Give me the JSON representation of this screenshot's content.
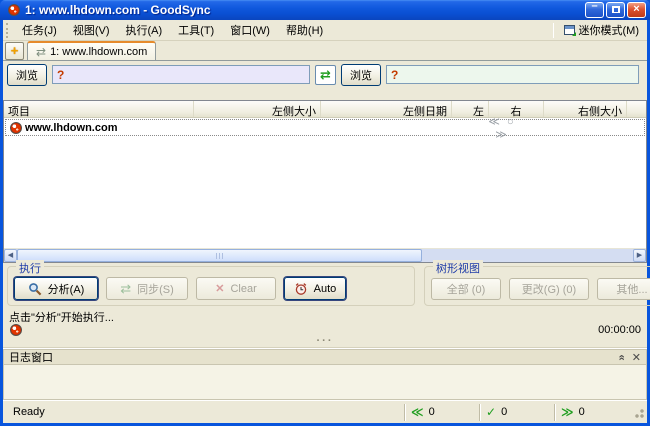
{
  "window": {
    "title": "1: www.lhdown.com - GoodSync",
    "controls": {
      "minimize": "–",
      "close": "×"
    }
  },
  "menu": {
    "items": [
      "任务(J)",
      "视图(V)",
      "执行(A)",
      "工具(T)",
      "窗口(W)",
      "帮助(H)"
    ],
    "mini_mode_label": "迷你模式(M)"
  },
  "tabbar": {
    "new_tab_label": "+",
    "tab_sync_icon": "⇄",
    "active_tab": "1: www.lhdown.com"
  },
  "sync_paths": {
    "left_browse_label": "浏览",
    "left_value": "?",
    "swap_icon": "⇄",
    "right_browse_label": "浏览",
    "right_value": "?"
  },
  "file_list": {
    "columns": [
      "项目",
      "左侧大小",
      "左侧日期",
      "左",
      "右",
      "右侧大小"
    ],
    "rows": [
      {
        "name": "www.lhdown.com",
        "direction_icons": "≪ ○ ≫"
      }
    ]
  },
  "execute_panel": {
    "title": "执行",
    "analyze_label": "分析(A)",
    "sync_label": "同步(S)",
    "sync_icon": "⇄",
    "clear_label": "Clear",
    "clear_icon": "✕",
    "auto_label": "Auto"
  },
  "tree_panel": {
    "title": "树形视图",
    "all_label": "全部  (0)",
    "changes_label": "更改(G)  (0)",
    "other_label": "其他..."
  },
  "status": {
    "hint": "点击\"分析\"开始执行...",
    "elapsed_time": "00:00:00"
  },
  "log_panel": {
    "title": "日志窗口",
    "collapse_icon": "«",
    "close_icon": "✕"
  },
  "status_bar": {
    "state": "Ready",
    "left_icon": "≪",
    "left_count": "0",
    "check_icon": "✓",
    "synced_count": "0",
    "right_icon": "≫",
    "right_count": "0"
  },
  "splitter_dots": "···",
  "colors": {
    "titlebar_blue": "#1058dd",
    "frame_blue": "#0855dd",
    "face_beige": "#ece9d8",
    "left_path_bg": "#e9e7fa",
    "right_path_bg": "#edf7ed",
    "question_red": "#c43c00",
    "accent_green": "#1f9e1f",
    "tab_accent_orange": "#e68b2c"
  }
}
